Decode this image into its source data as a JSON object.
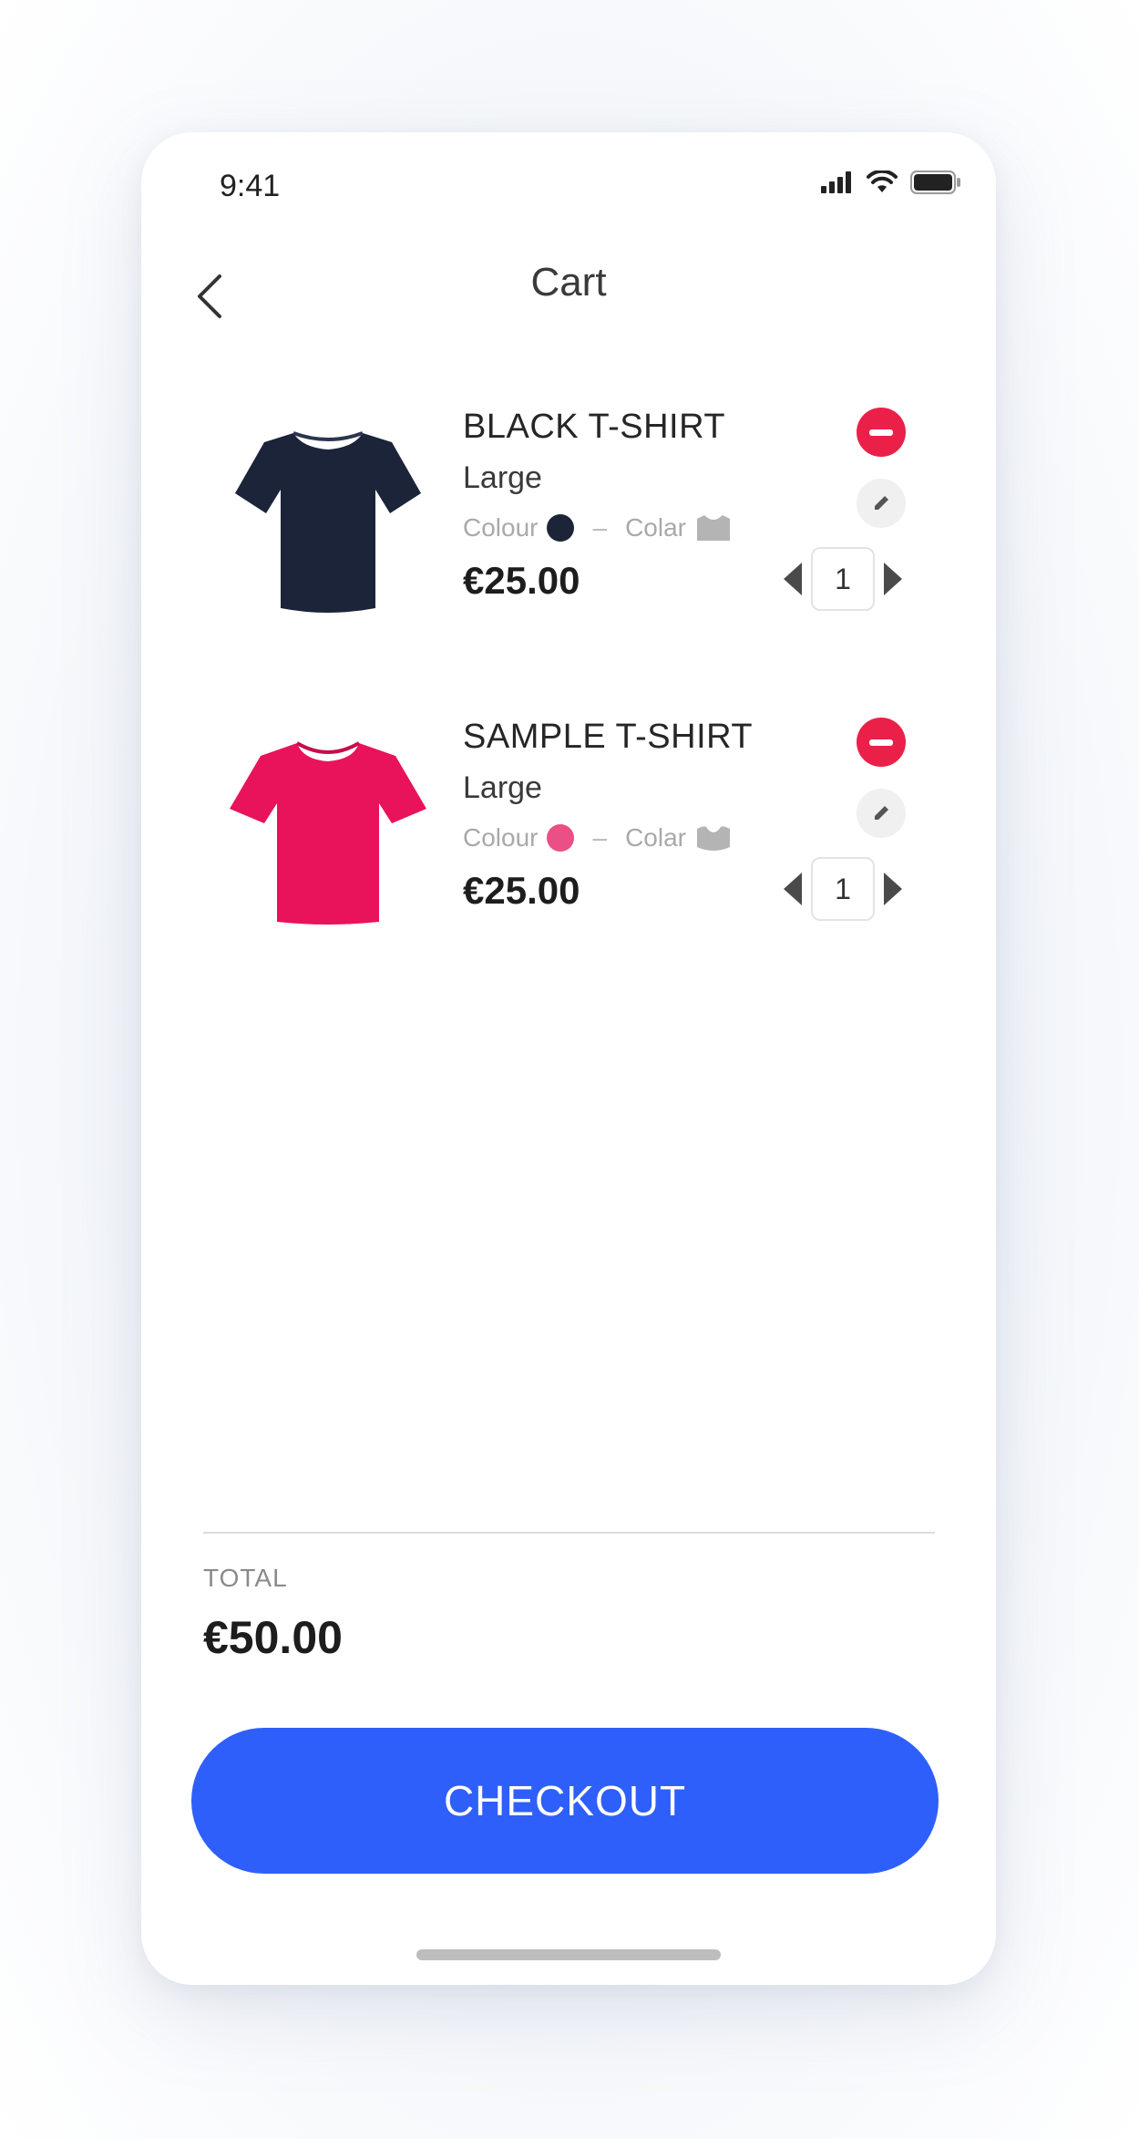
{
  "status_bar": {
    "time": "9:41"
  },
  "nav": {
    "title": "Cart"
  },
  "items": [
    {
      "name": "BLACK T-SHIRT",
      "size": "Large",
      "colour_label": "Colour",
      "colour": "#1c2438",
      "collar_label": "Colar",
      "price": "€25.00",
      "quantity": "1",
      "shirt_color": "#1b2438"
    },
    {
      "name": "SAMPLE T-SHIRT",
      "size": "Large",
      "colour_label": "Colour",
      "colour": "#ea4f86",
      "collar_label": "Colar",
      "price": "€25.00",
      "quantity": "1",
      "shirt_color": "#e8135a"
    }
  ],
  "summary": {
    "total_label": "TOTAL",
    "total_value": "€50.00"
  },
  "checkout_label": "CHECKOUT",
  "colors": {
    "accent": "#2e5ffa",
    "remove": "#eb2048"
  },
  "icons": [
    "back-chevron-icon",
    "signal-icon",
    "wifi-icon",
    "battery-icon",
    "remove-icon",
    "edit-pencil-icon",
    "decrement-arrow-icon",
    "increment-arrow-icon",
    "collar-icon"
  ]
}
